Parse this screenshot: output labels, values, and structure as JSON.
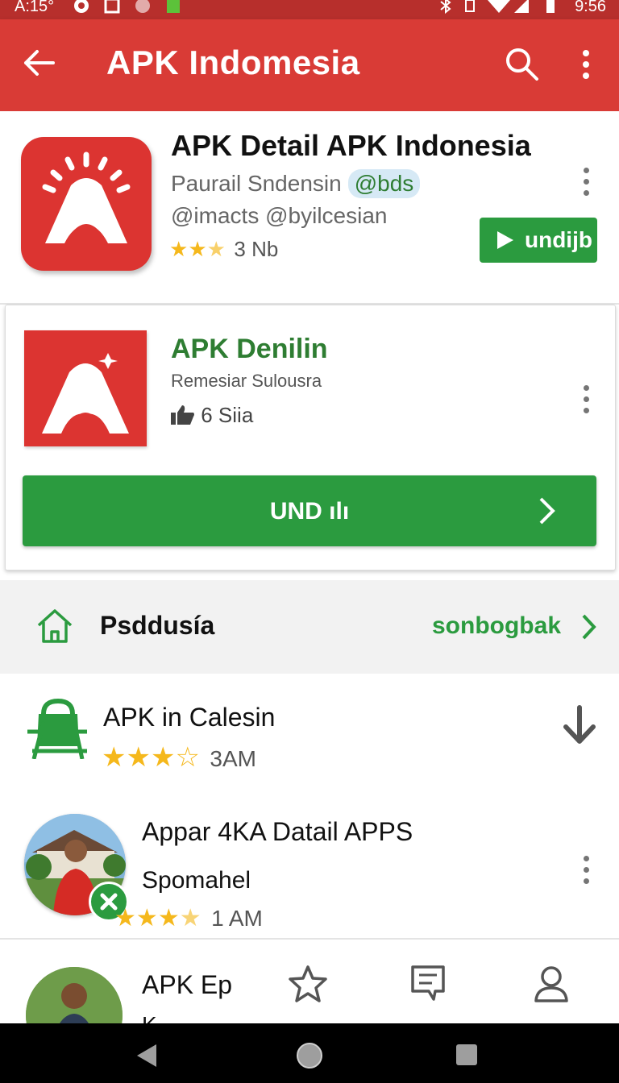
{
  "status_bar": {
    "time_left": "A:15°",
    "time_right": "9:56"
  },
  "app_bar": {
    "title": "APK Indomesia"
  },
  "featured": {
    "name": "APK Detail APK Indonesia",
    "developer": "Paurail Sndensin",
    "tag": "@bds",
    "subtitle": "@imacts @byilcesian",
    "rating_text": "3 Nb",
    "stars": 2.5,
    "install_label": "undijb"
  },
  "card": {
    "name": "APK Denilin",
    "subtitle": "Remesiar Sulousra",
    "likes": "6 Siia",
    "button_label": "UND ılı"
  },
  "section": {
    "title": "Psddusía",
    "link": "sonbogbak"
  },
  "list": [
    {
      "name": "APK in Calesin",
      "meta": "3AM",
      "stars": 3.5
    },
    {
      "name": "Appar 4KA Datail APPS",
      "subtitle": "Spomahel",
      "meta": "1 AM",
      "stars": 3.5
    },
    {
      "name": "APK Ep",
      "subtitle": "K"
    }
  ],
  "colors": {
    "app_bar": "#d93b36",
    "status_bar": "#b72f2c",
    "accent_green": "#2b9b3f",
    "icon_red": "#dc3431"
  }
}
